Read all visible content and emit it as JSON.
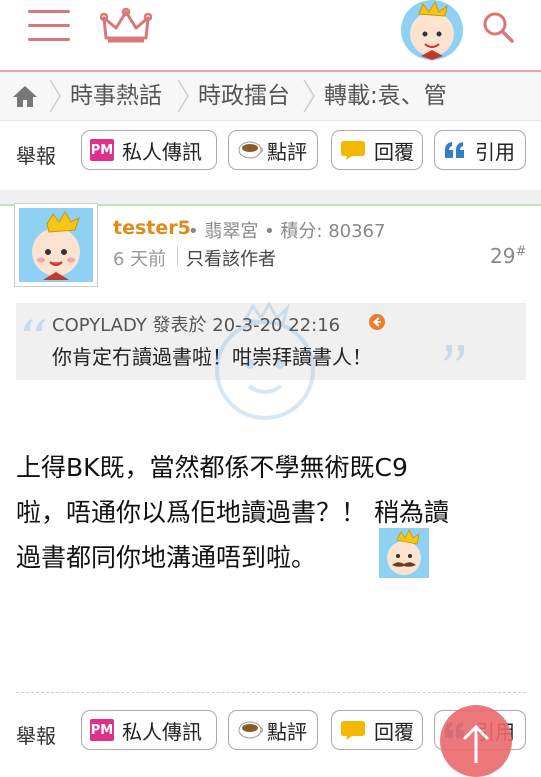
{
  "header": {
    "menu_icon": "hamburger-icon",
    "logo_icon": "crown-icon",
    "avatar_icon": "baby-avatar",
    "search_icon": "search-icon",
    "accent_color": "#d9777a"
  },
  "breadcrumb": {
    "home_icon": "home-icon",
    "items": [
      "時事熱話",
      "時政擂台",
      "轉載:袁、管"
    ]
  },
  "actions_top": {
    "report": "舉報",
    "pm": "私人傳訊",
    "pm_badge": "PM",
    "comment": "點評",
    "reply": "回覆",
    "quote": "引用"
  },
  "post": {
    "author": "tester5",
    "rank": "翡翠宮",
    "points_label": "積分: 80367",
    "time": "6 天前",
    "only_author": "只看該作者",
    "floor": "29",
    "floor_suffix": "#",
    "quote_author_line": "COPYLADY 發表於 20-3-20 22:16",
    "quote_text": "你肯定冇讀過書啦！咁崇拜讀書人！",
    "body_line1": "上得BK既，當然都係不學無術既C9",
    "body_line2": "啦，唔通你以爲佢地讀過書？！ 稍為讀",
    "body_line3": "過書都同你地溝通唔到啦。"
  },
  "actions_bottom": {
    "report": "舉報",
    "pm": "私人傳訊",
    "pm_badge": "PM",
    "comment": "點評",
    "reply": "回覆",
    "quote": "引用"
  }
}
